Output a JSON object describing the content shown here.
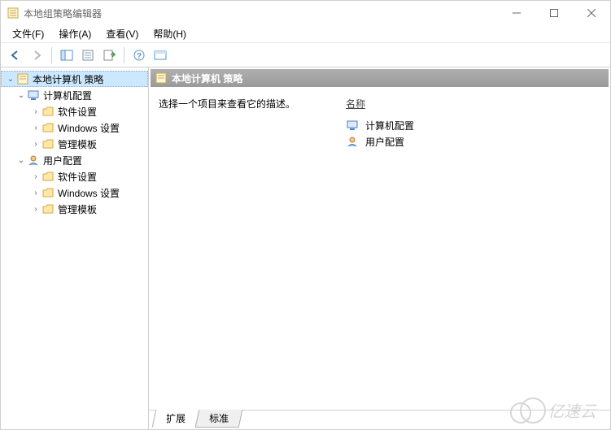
{
  "window": {
    "title": "本地组策略编辑器"
  },
  "menu": {
    "file": "文件(F)",
    "action": "操作(A)",
    "view": "查看(V)",
    "help": "帮助(H)"
  },
  "tree": {
    "root": "本地计算机 策略",
    "comp": "计算机配置",
    "comp_sw": "软件设置",
    "comp_win": "Windows 设置",
    "comp_adm": "管理模板",
    "user": "用户配置",
    "user_sw": "软件设置",
    "user_win": "Windows 设置",
    "user_adm": "管理模板"
  },
  "detail": {
    "header": "本地计算机 策略",
    "description": "选择一个项目来查看它的描述。",
    "name_col": "名称",
    "items": {
      "comp": "计算机配置",
      "user": "用户配置"
    }
  },
  "tabs": {
    "extended": "扩展",
    "standard": "标准"
  },
  "watermark": "亿速云"
}
